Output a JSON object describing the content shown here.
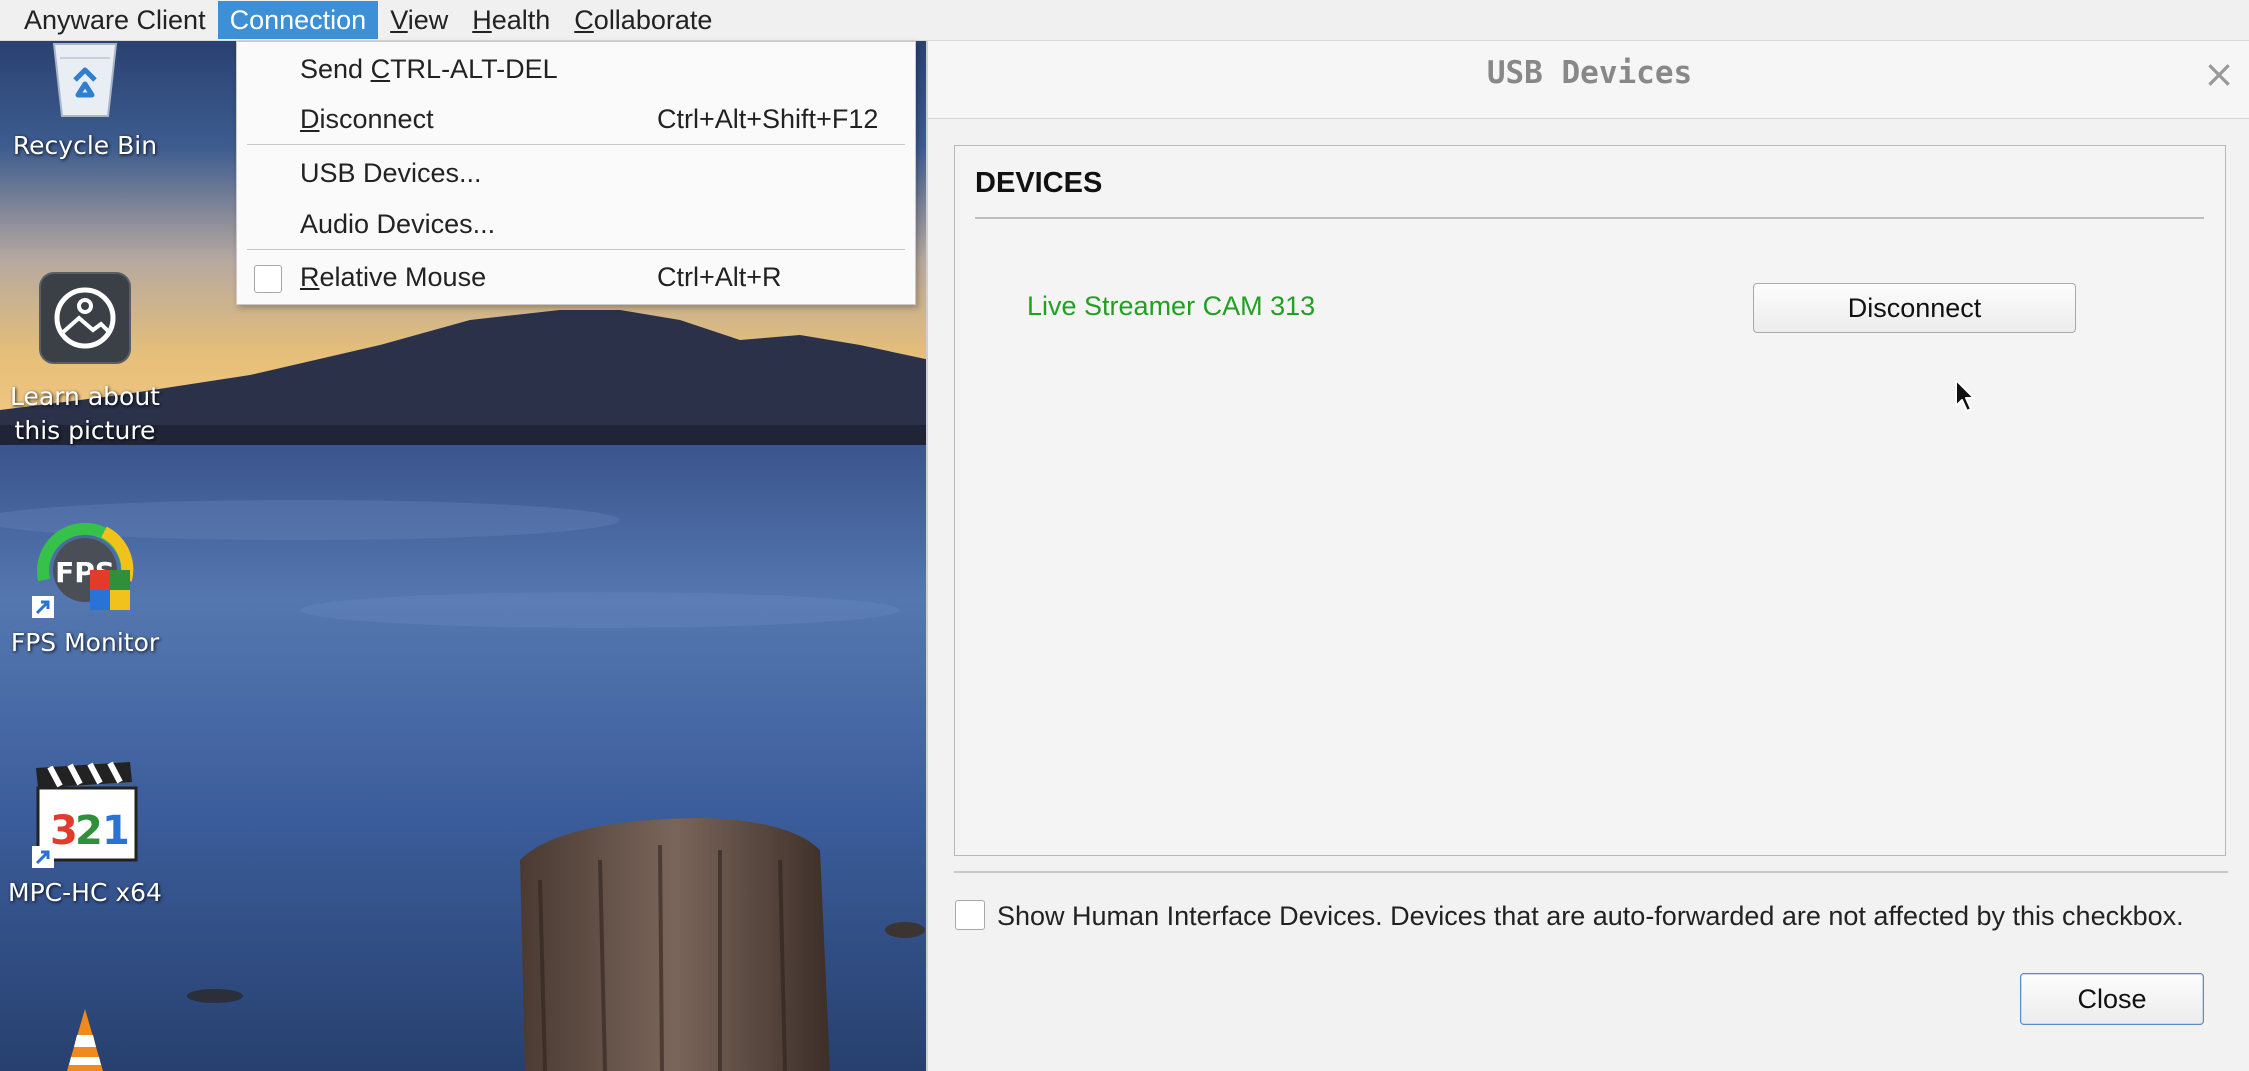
{
  "menubar": {
    "items": [
      {
        "pre": "",
        "key": "",
        "post": "Anyware Client"
      },
      {
        "pre": "",
        "key": "",
        "post": "Connection"
      },
      {
        "pre": "",
        "key": "V",
        "post": "iew"
      },
      {
        "pre": "",
        "key": "H",
        "post": "ealth"
      },
      {
        "pre": "",
        "key": "C",
        "post": "ollaborate"
      }
    ],
    "active_index": 1
  },
  "connection_menu": {
    "items": [
      {
        "pre": "Send ",
        "key": "C",
        "post": "TRL-ALT-DEL",
        "shortcut": ""
      },
      {
        "pre": "",
        "key": "D",
        "post": "isconnect",
        "shortcut": "Ctrl+Alt+Shift+F12"
      },
      {
        "pre": "USB Devices...",
        "key": "",
        "post": "",
        "shortcut": ""
      },
      {
        "pre": "Audio Devices...",
        "key": "",
        "post": "",
        "shortcut": ""
      },
      {
        "pre": "",
        "key": "R",
        "post": "elative Mouse",
        "shortcut": "Ctrl+Alt+R",
        "checked": false
      }
    ]
  },
  "desktop": {
    "icons": [
      {
        "label": "Recycle Bin",
        "icon": "recycle-bin-icon"
      },
      {
        "label": "Learn about this picture",
        "icon": "learn-about-picture-icon"
      },
      {
        "label": "FPS Monitor",
        "icon": "fps-monitor-icon"
      },
      {
        "label": "MPC-HC x64",
        "icon": "mpc-hc-icon"
      },
      {
        "label": "",
        "icon": "vlc-icon"
      }
    ]
  },
  "dialog": {
    "title": "USB Devices",
    "close_glyph": "×",
    "section_heading": "DEVICES",
    "devices": [
      {
        "name": "Live Streamer CAM 313",
        "action": "Disconnect",
        "status_color": "#22a022"
      }
    ],
    "hid_checkbox": {
      "checked": false,
      "label": "Show Human Interface Devices. Devices that are auto-forwarded are not affected by this checkbox."
    },
    "close_button": "Close"
  },
  "colors": {
    "menu_highlight": "#3d8fd6",
    "device_connected": "#22a022"
  }
}
